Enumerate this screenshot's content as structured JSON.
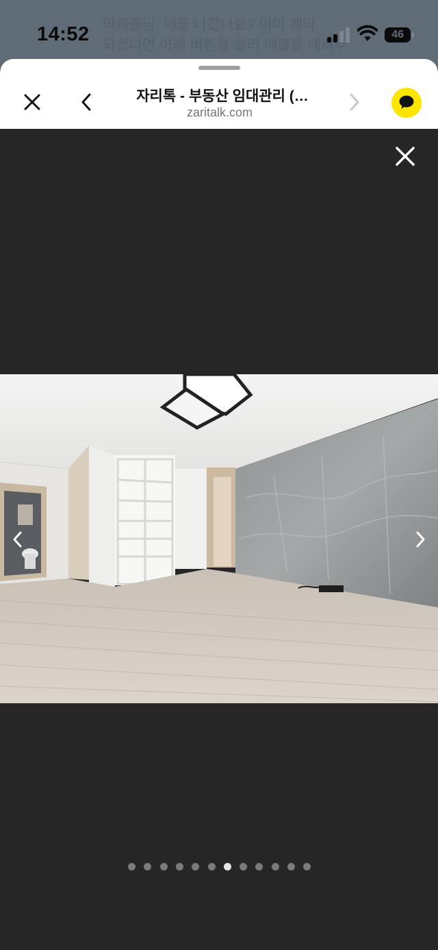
{
  "status_bar": {
    "time": "14:52",
    "battery_level": "46",
    "behind_text_line1": "악제출님, 매물 나갔나요? 이미 계약",
    "behind_text_line2": "되셨다면 아래 버튼을 눌러 매물을 내려주세"
  },
  "browser": {
    "title": "자리톡 - 부동산 임대관리 (…",
    "url": "zaritalk.com"
  },
  "gallery": {
    "photo_description": "empty living room with wood floor, gray stone wall, built-in shelves",
    "dot_count": 12,
    "active_index": 6
  }
}
